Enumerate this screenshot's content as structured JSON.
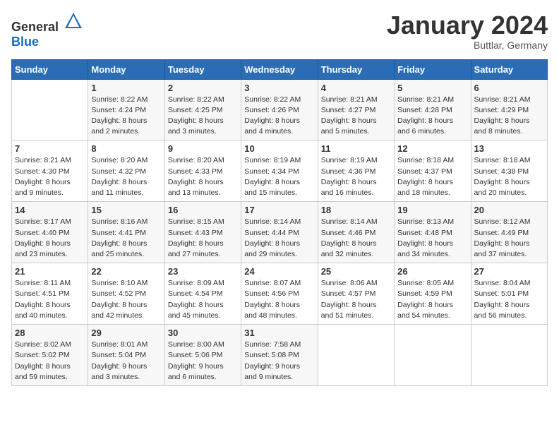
{
  "logo": {
    "general": "General",
    "blue": "Blue"
  },
  "title": "January 2024",
  "subtitle": "Buttlar, Germany",
  "days_header": [
    "Sunday",
    "Monday",
    "Tuesday",
    "Wednesday",
    "Thursday",
    "Friday",
    "Saturday"
  ],
  "weeks": [
    [
      {
        "day": "",
        "info": ""
      },
      {
        "day": "1",
        "info": "Sunrise: 8:22 AM\nSunset: 4:24 PM\nDaylight: 8 hours\nand 2 minutes."
      },
      {
        "day": "2",
        "info": "Sunrise: 8:22 AM\nSunset: 4:25 PM\nDaylight: 8 hours\nand 3 minutes."
      },
      {
        "day": "3",
        "info": "Sunrise: 8:22 AM\nSunset: 4:26 PM\nDaylight: 8 hours\nand 4 minutes."
      },
      {
        "day": "4",
        "info": "Sunrise: 8:21 AM\nSunset: 4:27 PM\nDaylight: 8 hours\nand 5 minutes."
      },
      {
        "day": "5",
        "info": "Sunrise: 8:21 AM\nSunset: 4:28 PM\nDaylight: 8 hours\nand 6 minutes."
      },
      {
        "day": "6",
        "info": "Sunrise: 8:21 AM\nSunset: 4:29 PM\nDaylight: 8 hours\nand 8 minutes."
      }
    ],
    [
      {
        "day": "7",
        "info": "Sunrise: 8:21 AM\nSunset: 4:30 PM\nDaylight: 8 hours\nand 9 minutes."
      },
      {
        "day": "8",
        "info": "Sunrise: 8:20 AM\nSunset: 4:32 PM\nDaylight: 8 hours\nand 11 minutes."
      },
      {
        "day": "9",
        "info": "Sunrise: 8:20 AM\nSunset: 4:33 PM\nDaylight: 8 hours\nand 13 minutes."
      },
      {
        "day": "10",
        "info": "Sunrise: 8:19 AM\nSunset: 4:34 PM\nDaylight: 8 hours\nand 15 minutes."
      },
      {
        "day": "11",
        "info": "Sunrise: 8:19 AM\nSunset: 4:36 PM\nDaylight: 8 hours\nand 16 minutes."
      },
      {
        "day": "12",
        "info": "Sunrise: 8:18 AM\nSunset: 4:37 PM\nDaylight: 8 hours\nand 18 minutes."
      },
      {
        "day": "13",
        "info": "Sunrise: 8:18 AM\nSunset: 4:38 PM\nDaylight: 8 hours\nand 20 minutes."
      }
    ],
    [
      {
        "day": "14",
        "info": "Sunrise: 8:17 AM\nSunset: 4:40 PM\nDaylight: 8 hours\nand 23 minutes."
      },
      {
        "day": "15",
        "info": "Sunrise: 8:16 AM\nSunset: 4:41 PM\nDaylight: 8 hours\nand 25 minutes."
      },
      {
        "day": "16",
        "info": "Sunrise: 8:15 AM\nSunset: 4:43 PM\nDaylight: 8 hours\nand 27 minutes."
      },
      {
        "day": "17",
        "info": "Sunrise: 8:14 AM\nSunset: 4:44 PM\nDaylight: 8 hours\nand 29 minutes."
      },
      {
        "day": "18",
        "info": "Sunrise: 8:14 AM\nSunset: 4:46 PM\nDaylight: 8 hours\nand 32 minutes."
      },
      {
        "day": "19",
        "info": "Sunrise: 8:13 AM\nSunset: 4:48 PM\nDaylight: 8 hours\nand 34 minutes."
      },
      {
        "day": "20",
        "info": "Sunrise: 8:12 AM\nSunset: 4:49 PM\nDaylight: 8 hours\nand 37 minutes."
      }
    ],
    [
      {
        "day": "21",
        "info": "Sunrise: 8:11 AM\nSunset: 4:51 PM\nDaylight: 8 hours\nand 40 minutes."
      },
      {
        "day": "22",
        "info": "Sunrise: 8:10 AM\nSunset: 4:52 PM\nDaylight: 8 hours\nand 42 minutes."
      },
      {
        "day": "23",
        "info": "Sunrise: 8:09 AM\nSunset: 4:54 PM\nDaylight: 8 hours\nand 45 minutes."
      },
      {
        "day": "24",
        "info": "Sunrise: 8:07 AM\nSunset: 4:56 PM\nDaylight: 8 hours\nand 48 minutes."
      },
      {
        "day": "25",
        "info": "Sunrise: 8:06 AM\nSunset: 4:57 PM\nDaylight: 8 hours\nand 51 minutes."
      },
      {
        "day": "26",
        "info": "Sunrise: 8:05 AM\nSunset: 4:59 PM\nDaylight: 8 hours\nand 54 minutes."
      },
      {
        "day": "27",
        "info": "Sunrise: 8:04 AM\nSunset: 5:01 PM\nDaylight: 8 hours\nand 56 minutes."
      }
    ],
    [
      {
        "day": "28",
        "info": "Sunrise: 8:02 AM\nSunset: 5:02 PM\nDaylight: 8 hours\nand 59 minutes."
      },
      {
        "day": "29",
        "info": "Sunrise: 8:01 AM\nSunset: 5:04 PM\nDaylight: 9 hours\nand 3 minutes."
      },
      {
        "day": "30",
        "info": "Sunrise: 8:00 AM\nSunset: 5:06 PM\nDaylight: 9 hours\nand 6 minutes."
      },
      {
        "day": "31",
        "info": "Sunrise: 7:58 AM\nSunset: 5:08 PM\nDaylight: 9 hours\nand 9 minutes."
      },
      {
        "day": "",
        "info": ""
      },
      {
        "day": "",
        "info": ""
      },
      {
        "day": "",
        "info": ""
      }
    ]
  ]
}
